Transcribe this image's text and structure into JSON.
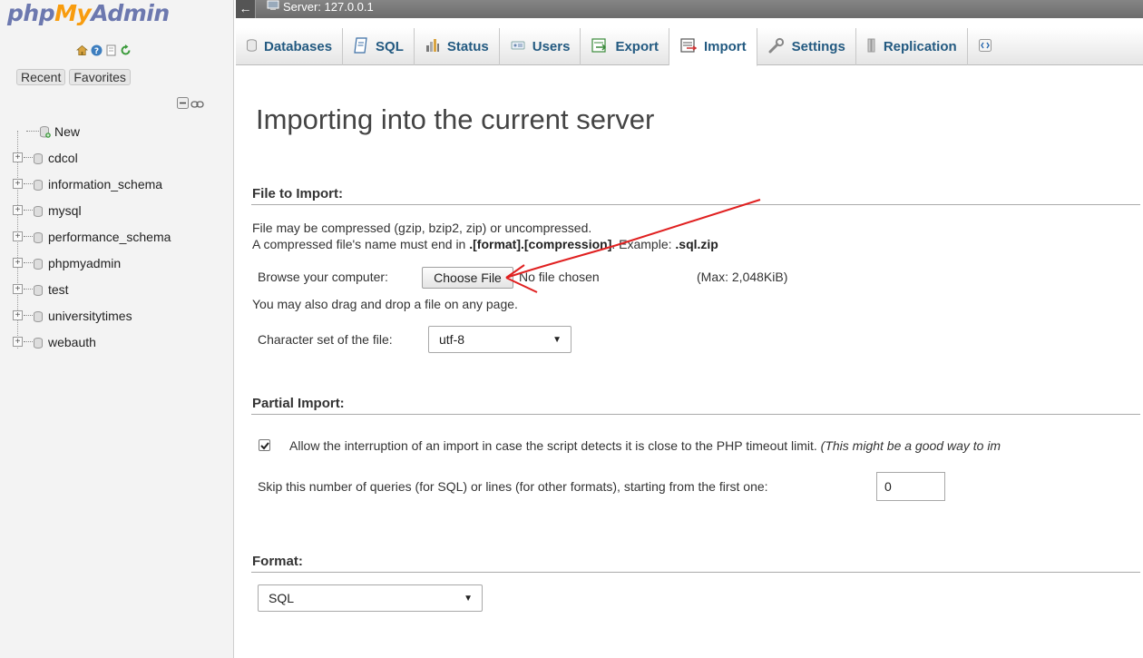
{
  "sidebar": {
    "logo": {
      "part1": "php",
      "part2": "My",
      "part3": "Admin"
    },
    "quick_icons": [
      "home-icon",
      "help-icon",
      "docs-icon",
      "reload-icon"
    ],
    "tabs": {
      "recent": "Recent",
      "favorites": "Favorites"
    },
    "tree": {
      "new_label": "New",
      "databases": [
        "cdcol",
        "information_schema",
        "mysql",
        "performance_schema",
        "phpmyadmin",
        "test",
        "universitytimes",
        "webauth"
      ]
    }
  },
  "topbar": {
    "back_arrow": "←",
    "server_label": "Server: 127.0.0.1"
  },
  "menu": {
    "items": [
      {
        "label": "Databases",
        "icon": "databases-icon"
      },
      {
        "label": "SQL",
        "icon": "sql-icon"
      },
      {
        "label": "Status",
        "icon": "status-icon"
      },
      {
        "label": "Users",
        "icon": "users-icon"
      },
      {
        "label": "Export",
        "icon": "export-icon"
      },
      {
        "label": "Import",
        "icon": "import-icon",
        "active": true
      },
      {
        "label": "Settings",
        "icon": "settings-icon"
      },
      {
        "label": "Replication",
        "icon": "replication-icon"
      }
    ]
  },
  "main": {
    "title": "Importing into the current server",
    "file_section": {
      "heading": "File to Import:",
      "line1": "File may be compressed (gzip, bzip2, zip) or uncompressed.",
      "line2_prefix": "A compressed file's name must end in ",
      "line2_bold": ".[format].[compression]",
      "line2_mid": ". Example: ",
      "line2_example": ".sql.zip",
      "browse_label": "Browse your computer:",
      "choose_file": "Choose File",
      "no_file": "No file chosen",
      "max_size": "(Max: 2,048KiB)",
      "drag_hint": "You may also drag and drop a file on any page.",
      "charset_label": "Character set of the file:",
      "charset_value": "utf-8"
    },
    "partial_section": {
      "heading": "Partial Import:",
      "allow_text": "Allow the interruption of an import in case the script detects it is close to the PHP timeout limit.",
      "allow_note": "(This might be a good way to im",
      "allow_checked": true,
      "skip_label": "Skip this number of queries (for SQL) or lines (for other formats), starting from the first one:",
      "skip_value": "0"
    },
    "format_section": {
      "heading": "Format:",
      "format_value": "SQL"
    }
  },
  "colors": {
    "link_blue": "#235a81",
    "annotation_red": "#e02020",
    "logo_blue": "#6c78af",
    "logo_orange": "#f89c0e"
  }
}
